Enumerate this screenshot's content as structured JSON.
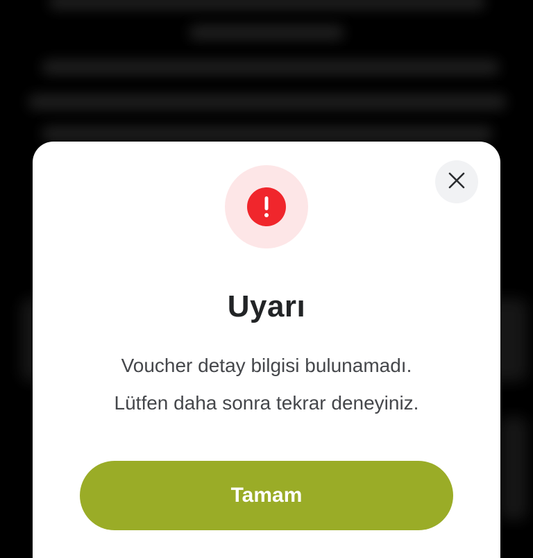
{
  "dialog": {
    "title": "Uyarı",
    "message_lines": [
      "Voucher detay bilgisi bulunamadı.",
      "Lütfen daha sonra tekrar deneyiniz."
    ],
    "confirm_label": "Tamam",
    "icons": {
      "close": "close-icon",
      "alert": "exclamation-alert-icon"
    },
    "colors": {
      "accent_button": "#9aac27",
      "alert_red": "#f0262c",
      "alert_halo": "#fde6e7",
      "title_text": "#222426",
      "body_text": "#45474b",
      "backdrop": "#000000"
    }
  }
}
